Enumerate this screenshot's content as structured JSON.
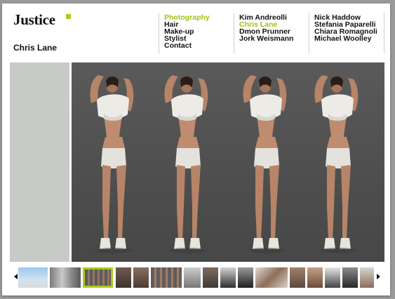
{
  "brand": {
    "name": "Justice",
    "accent": "#a8cc1e"
  },
  "current_artist": "Chris Lane",
  "nav": {
    "categories": [
      {
        "label": "Photography",
        "active": true
      },
      {
        "label": "Hair",
        "active": false
      },
      {
        "label": "Make-up",
        "active": false
      },
      {
        "label": "Stylist",
        "active": false
      },
      {
        "label": "Contact",
        "active": false
      }
    ],
    "artists_col1": [
      {
        "label": "Kim Andreolli",
        "active": false
      },
      {
        "label": "Chris Lane",
        "active": true
      },
      {
        "label": "Dmon Prunner",
        "active": false
      },
      {
        "label": "Jork Weismann",
        "active": false
      }
    ],
    "artists_col2": [
      {
        "label": "Nick Haddow",
        "active": false
      },
      {
        "label": "Stefania Paparelli",
        "active": false
      },
      {
        "label": "Chiara Romagnoli",
        "active": false
      },
      {
        "label": "Michael Woolley",
        "active": false
      }
    ]
  },
  "gallery": {
    "prev_icon": "arrow-left-icon",
    "next_icon": "arrow-right-icon",
    "selected_thumbnail": 3,
    "thumbnail_count": 17
  }
}
